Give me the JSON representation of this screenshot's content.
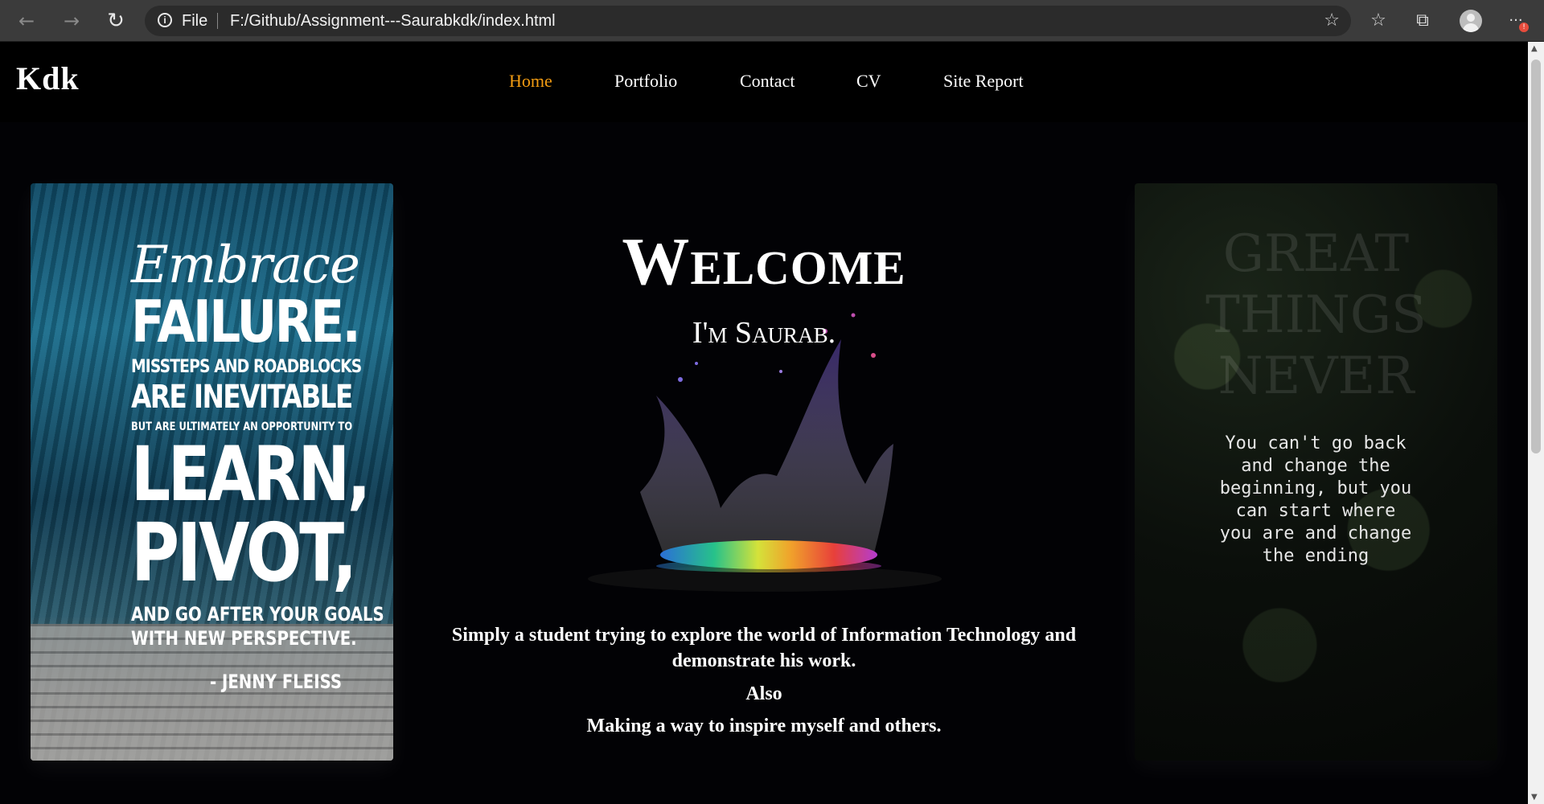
{
  "browser": {
    "back_icon": "←",
    "forward_icon": "→",
    "reload_icon": "↻",
    "info_icon": "i",
    "file_label": "File",
    "url": "F:/Github/Assignment---Saurabkdk/index.html",
    "add_favorite_icon": "☆",
    "favorites_icon": "☆",
    "collections_icon": "⧉",
    "menu_icon": "···",
    "notification_badge": "!"
  },
  "site": {
    "logo": "Kdk",
    "nav": {
      "home": "Home",
      "portfolio": "Portfolio",
      "contact": "Contact",
      "cv": "CV",
      "site_report": "Site Report"
    },
    "active_nav_color": "#f39c12"
  },
  "hero": {
    "welcome": "Welcome",
    "intro": "I'm Saurab.",
    "description": "Simply a student trying to explore the world of Information Technology and demonstrate his work.",
    "also": "Also",
    "inspire": "Making a way to inspire myself and others."
  },
  "left_poster": {
    "embrace": "Embrace",
    "failure": "FAILURE.",
    "missteps": "MISSTEPS AND ROADBLOCKS",
    "inevitable": "ARE INEVITABLE",
    "opportunity": "BUT ARE ULTIMATELY AN OPPORTUNITY TO",
    "learn": "LEARN,",
    "pivot": "PIVOT,",
    "goals": "AND GO AFTER YOUR GOALS",
    "perspective": "WITH NEW PERSPECTIVE.",
    "author": "- JENNY FLEISS"
  },
  "right_card": {
    "ghost_line1": "GREAT",
    "ghost_line2": "THINGS",
    "ghost_line3": "NEVER",
    "quote": "You can't go back and change the beginning, but you can start where you are and change the ending"
  }
}
